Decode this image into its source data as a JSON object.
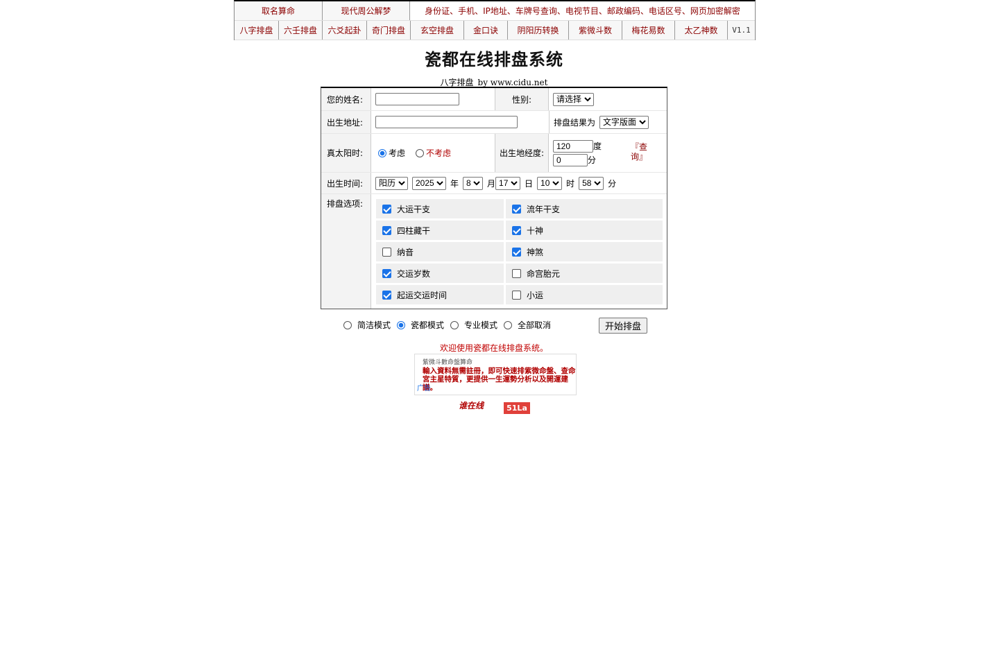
{
  "nav": {
    "row1": [
      "取名算命",
      "现代周公解梦"
    ],
    "row1_links": "身份证、手机、IP地址、车牌号查询、电视节目、邮政编码、电话区号、网页加密解密",
    "row2": [
      "八字排盘",
      "六壬排盘",
      "六爻起卦",
      "奇门排盘",
      "玄空排盘",
      "金口诀",
      "阴阳历转换",
      "紫微斗数",
      "梅花易数",
      "太乙神数"
    ],
    "version": "V1.1"
  },
  "title": "瓷都在线排盘系统",
  "subtitle": "八字排盘_by www.cidu.net",
  "form": {
    "name_label": "您的姓名:",
    "name_value": "",
    "gender_label": "性别:",
    "gender_value": "请选择",
    "address_label": "出生地址:",
    "address_value": "",
    "result_label": "排盘结果为",
    "result_value": "文字版面",
    "solar_label": "真太阳时:",
    "solar_yes": "考虑",
    "solar_no": "不考虑",
    "longitude_label": "出生地经度:",
    "longitude_deg": "120",
    "deg_unit": "度",
    "longitude_min": "0",
    "min_unit": "分",
    "query_link": "『查询』",
    "time_label": "出生时间:",
    "calendar": "阳历",
    "year": "2025",
    "year_unit": "年",
    "month": "8",
    "month_unit": "月",
    "day": "17",
    "day_unit": "日",
    "hour": "10",
    "hour_unit": "时",
    "minute": "58",
    "minute_unit": "分",
    "options_label": "排盘选项:",
    "options": [
      {
        "label": "大运干支",
        "checked": true
      },
      {
        "label": "流年干支",
        "checked": true
      },
      {
        "label": "四柱藏干",
        "checked": true
      },
      {
        "label": "十神",
        "checked": true
      },
      {
        "label": "纳音",
        "checked": false
      },
      {
        "label": "神煞",
        "checked": true
      },
      {
        "label": "交运岁数",
        "checked": true
      },
      {
        "label": "命宫胎元",
        "checked": false
      },
      {
        "label": "起运交运时间",
        "checked": true
      },
      {
        "label": "小运",
        "checked": false
      }
    ]
  },
  "modes": [
    "简洁模式",
    "瓷都模式",
    "专业模式",
    "全部取消"
  ],
  "selected_mode": "瓷都模式",
  "start_button": "开始排盘",
  "welcome": "欢迎使用瓷都在线排盘系统。",
  "ad": {
    "heading": "紫微斗數命盤算命",
    "body": "輸入資料無需註冊，即可快速排紫微命盤、查命宮主星特質，更提供一生運勢分析以及開運建議。",
    "tag": "广告"
  },
  "footer": {
    "stamp": "谁在线",
    "badge": "51La"
  },
  "colors": {
    "accent": "#8b0000",
    "welcome": "#c00000",
    "badge": "#e0403a"
  }
}
